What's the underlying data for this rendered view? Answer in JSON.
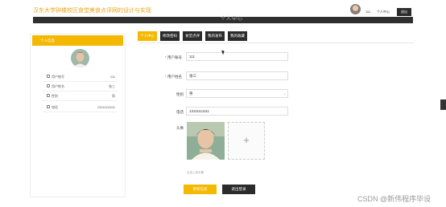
{
  "header": {
    "site_title": "汉东大学钟楼校区食堂美食点评网的设计与实现",
    "user_name": "111",
    "personal_center": "个人中心",
    "logout_label": "退出",
    "bar_text": "个人中心"
  },
  "sidebar": {
    "title": "个人信息",
    "rows": [
      {
        "label": "用户账号",
        "value": "111"
      },
      {
        "label": "用户姓名",
        "value": "张三"
      },
      {
        "label": "性别",
        "value": "男"
      },
      {
        "label": "电话",
        "value": "13111111111"
      }
    ]
  },
  "tabs": [
    {
      "label": "个人中心",
      "active": true
    },
    {
      "label": "修改密码",
      "active": false
    },
    {
      "label": "食堂点评",
      "active": false
    },
    {
      "label": "我的发布",
      "active": false
    },
    {
      "label": "我的收藏",
      "active": false
    }
  ],
  "form": {
    "account_label": "用户账号",
    "account_value": "111",
    "name_label": "用户姓名",
    "name_value": "张三",
    "gender_label": "性别",
    "gender_value": "男",
    "phone_label": "电话",
    "phone_value": "13111111111",
    "avatar_label": "头像",
    "upload_plus": "+",
    "upload_hint": "点击上传头像",
    "update_label": "更新信息",
    "logout_label": "退出登录"
  },
  "watermark": "CSDN @新伟程序毕设",
  "colors": {
    "accent": "#f5b800",
    "dark": "#2b2b2b",
    "title": "#e8a317"
  }
}
